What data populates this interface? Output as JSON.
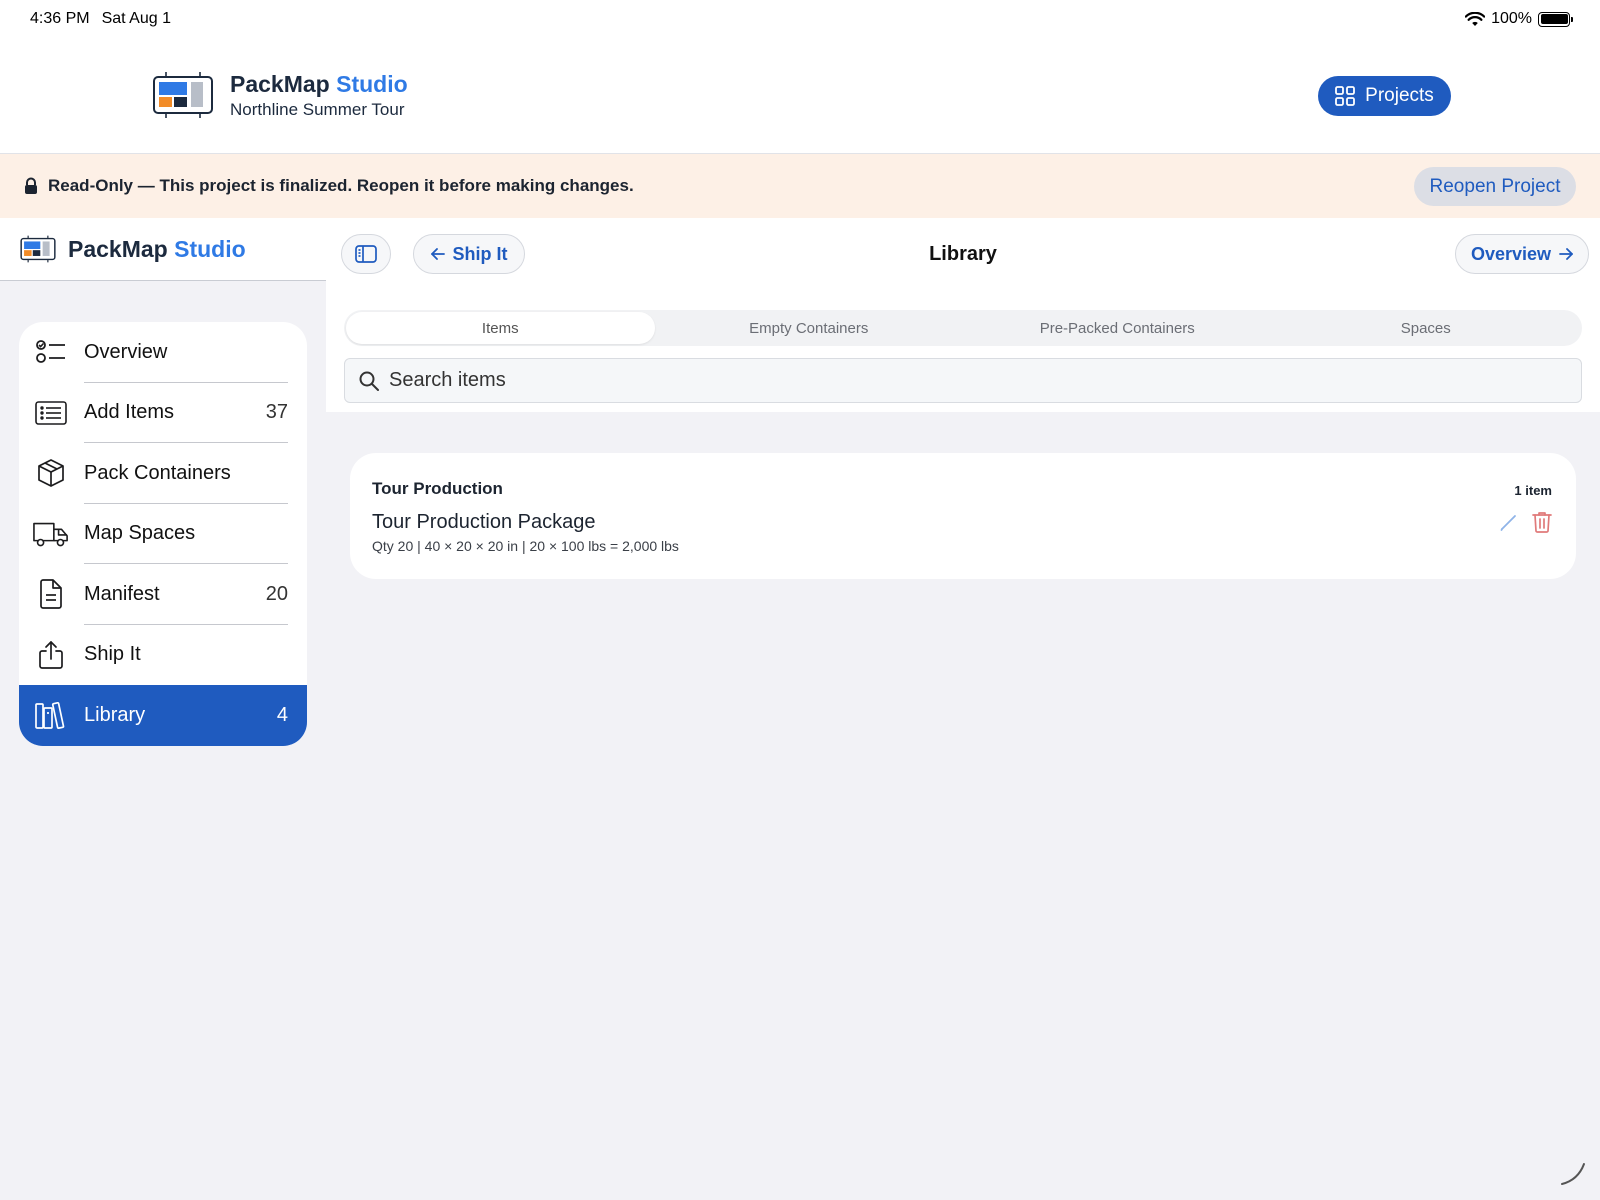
{
  "status": {
    "time": "4:36 PM",
    "date": "Sat Aug 1",
    "battery": "100%"
  },
  "header": {
    "app_name_primary": "PackMap",
    "app_name_accent": "Studio",
    "project_name": "Northline Summer Tour",
    "projects_label": "Projects"
  },
  "banner": {
    "text": "Read-Only — This project is finalized. Reopen it before making changes.",
    "reopen_label": "Reopen Project"
  },
  "sidebar": {
    "title_primary": "PackMap",
    "title_accent": "Studio",
    "items": [
      {
        "label": "Overview",
        "count": "",
        "icon": "checklist-icon"
      },
      {
        "label": "Add Items",
        "count": "37",
        "icon": "list-icon"
      },
      {
        "label": "Pack Containers",
        "count": "",
        "icon": "box-icon"
      },
      {
        "label": "Map Spaces",
        "count": "",
        "icon": "truck-icon"
      },
      {
        "label": "Manifest",
        "count": "20",
        "icon": "document-icon"
      },
      {
        "label": "Ship It",
        "count": "",
        "icon": "share-icon"
      },
      {
        "label": "Library",
        "count": "4",
        "icon": "library-icon",
        "active": true
      }
    ]
  },
  "main": {
    "back_label": "Ship It",
    "title": "Library",
    "forward_label": "Overview",
    "tabs": [
      {
        "label": "Items",
        "selected": true
      },
      {
        "label": "Empty Containers",
        "selected": false
      },
      {
        "label": "Pre-Packed Containers",
        "selected": false
      },
      {
        "label": "Spaces",
        "selected": false
      }
    ],
    "search_placeholder": "Search items"
  },
  "library": {
    "group_name": "Tour Production",
    "group_count": "1 item",
    "items": [
      {
        "name": "Tour Production Package",
        "detail": "Qty 20 | 40 × 20 × 20 in | 20 × 100 lbs = 2,000 lbs"
      }
    ]
  },
  "colors": {
    "accent": "#1f5bbf",
    "brand_accent": "#2f7ae5",
    "banner_bg": "#fdf0e6",
    "danger": "#e07a7a"
  }
}
